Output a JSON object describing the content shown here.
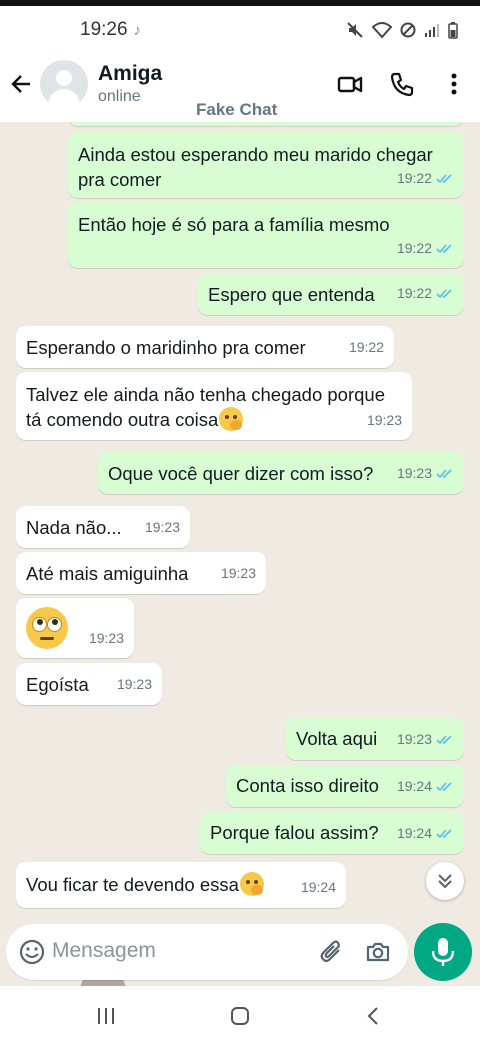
{
  "status_bar": {
    "time": "19:26"
  },
  "header": {
    "contact_name": "Amiga",
    "contact_status": "online",
    "watermark": "Fake Chat"
  },
  "messages": [
    {
      "direction": "out",
      "text": "Ainda estou esperando meu marido chegar pra comer",
      "time": "19:22",
      "read": true
    },
    {
      "direction": "out",
      "text": "Então hoje é só para a família mesmo",
      "time": "19:22",
      "read": true
    },
    {
      "direction": "out",
      "text": "Espero que entenda",
      "time": "19:22",
      "read": true
    },
    {
      "direction": "in",
      "text": "Esperando o maridinho pra comer",
      "time": "19:22"
    },
    {
      "direction": "in",
      "text": "Talvez ele ainda não tenha chegado porque tá comendo outra coisa",
      "emoji": "shushing-face",
      "time": "19:23"
    },
    {
      "direction": "out",
      "text": "Oque você quer dizer com isso?",
      "time": "19:23",
      "read": true
    },
    {
      "direction": "in",
      "text": "Nada não...",
      "time": "19:23"
    },
    {
      "direction": "in",
      "text": "Até mais amiguinha",
      "time": "19:23"
    },
    {
      "direction": "in",
      "text": "",
      "emoji": "rolling-eyes-face",
      "time": "19:23"
    },
    {
      "direction": "in",
      "text": "Egoísta",
      "time": "19:23"
    },
    {
      "direction": "out",
      "text": "Volta aqui",
      "time": "19:23",
      "read": true
    },
    {
      "direction": "out",
      "text": "Conta isso direito",
      "time": "19:24",
      "read": true
    },
    {
      "direction": "out",
      "text": "Porque falou assim?",
      "time": "19:24",
      "read": true
    },
    {
      "direction": "in",
      "text": "Vou ficar te devendo essa",
      "emoji": "shushing-face",
      "time": "19:24"
    }
  ],
  "composer": {
    "placeholder": "Mensagem"
  },
  "colors": {
    "outgoing_bubble": "#d9fdd3",
    "incoming_bubble": "#ffffff",
    "chat_background": "#efeae2",
    "accent": "#00a884",
    "read_ticks": "#53bdeb"
  },
  "icons": {
    "back": "arrow-left-icon",
    "video": "video-call-icon",
    "call": "phone-icon",
    "menu": "more-vertical-icon",
    "emoji": "emoji-icon",
    "attach": "paperclip-icon",
    "camera": "camera-icon",
    "mic": "microphone-icon",
    "scroll_down": "double-chevron-down-icon"
  }
}
